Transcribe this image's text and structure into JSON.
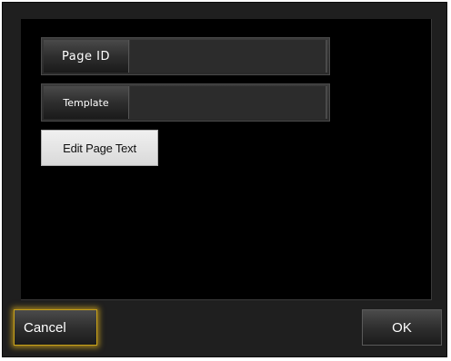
{
  "fields": {
    "page_id": {
      "label": "Page ID",
      "value": ""
    },
    "template": {
      "label": "Template",
      "value": ""
    }
  },
  "buttons": {
    "edit_page_text": "Edit Page Text",
    "cancel": "Cancel",
    "ok": "OK"
  },
  "colors": {
    "dialog_background": "#1f1f1f",
    "panel_background": "#000000",
    "focus_glow": "#d6aa1e",
    "light_button": "#e6e6e6"
  }
}
